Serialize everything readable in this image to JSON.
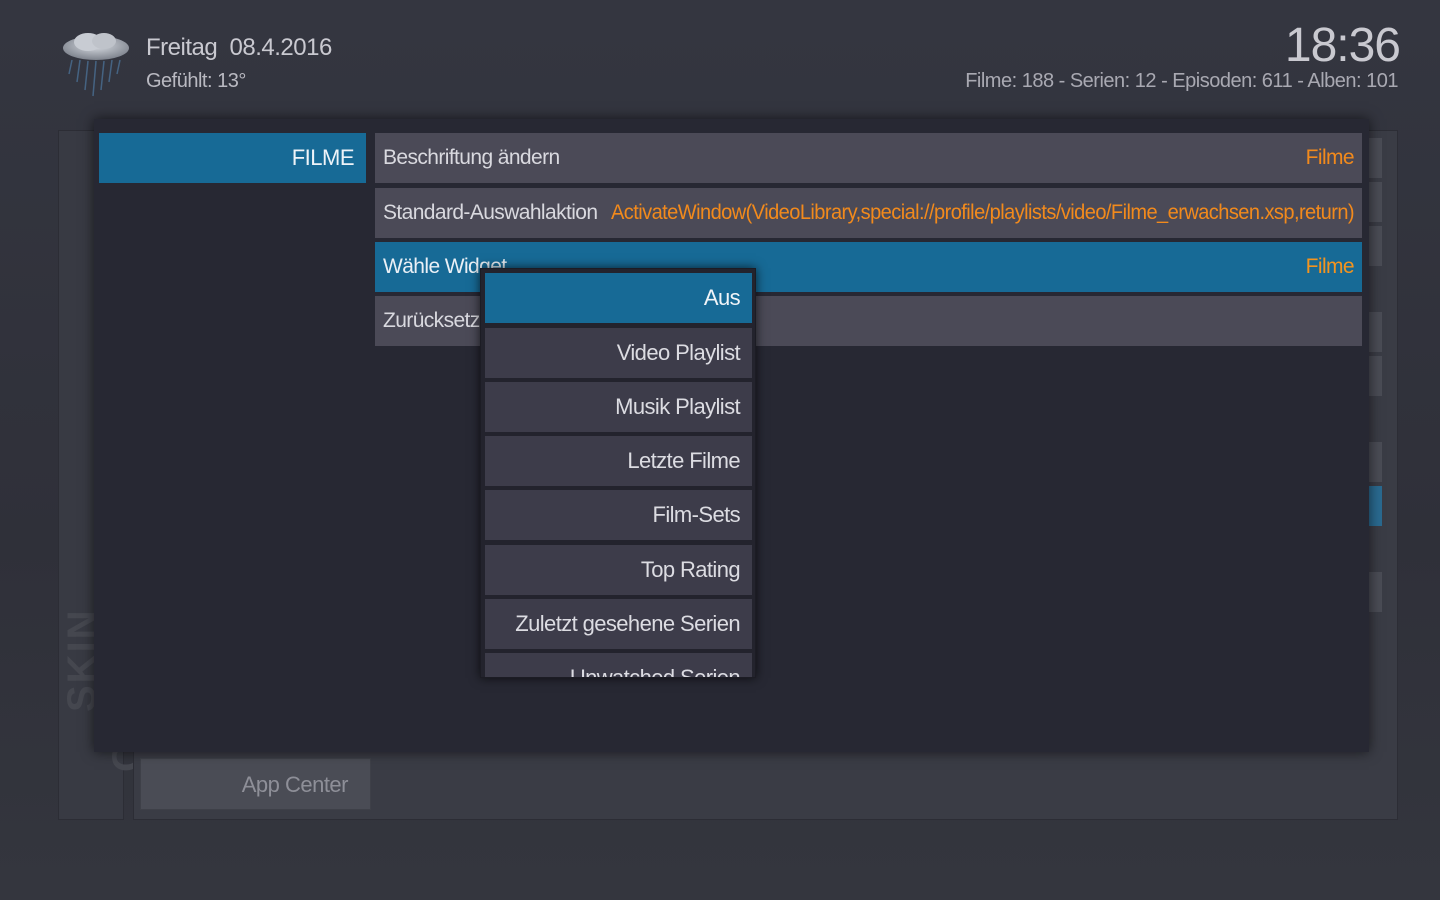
{
  "header": {
    "day": "Freitag",
    "date": "08.4.2016",
    "felt_temp": "Gefühlt: 13°",
    "clock": "18:36",
    "library_stats": "Filme: 188 - Serien: 12 - Episoden: 611 - Alben: 101",
    "weather_icon": "rain-cloud-icon"
  },
  "background": {
    "side_label": "SKIN OPTIONEN",
    "app_center": "App Center"
  },
  "dialog": {
    "category": "FILME",
    "options": [
      {
        "label": "Beschriftung ändern",
        "value": "Filme"
      },
      {
        "label": "Standard-Auswahlaktion",
        "value": "ActivateWindow(VideoLibrary,special://profile/playlists/video/Filme_erwachsen.xsp,return)"
      },
      {
        "label": "Wähle Widget",
        "value": "Filme"
      },
      {
        "label": "Zurücksetzen",
        "value": ""
      }
    ]
  },
  "popup": {
    "items": [
      "Aus",
      "Video Playlist",
      "Musik Playlist",
      "Letzte Filme",
      "Film-Sets",
      "Top Rating",
      "Zuletzt gesehene Serien",
      "Unwatched Serien"
    ],
    "selected": "Aus"
  },
  "colors": {
    "accent": "#176a96",
    "value_orange": "#f28a1c",
    "row_bg": "#4b4a57"
  }
}
